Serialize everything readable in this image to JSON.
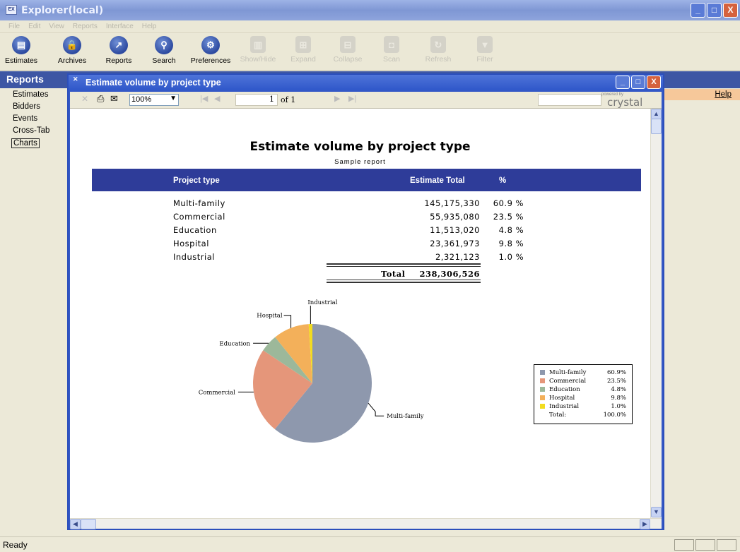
{
  "app": {
    "title": "Explorer(local)",
    "icon": "app-window-icon",
    "icon_text": "EX"
  },
  "window_controls": {
    "minimize": "_",
    "maximize": "□",
    "close": "X"
  },
  "menu": [
    "File",
    "Edit",
    "View",
    "Reports",
    "Interface",
    "Help"
  ],
  "toolbar": [
    {
      "label": "Estimates",
      "icon": "estimates-icon",
      "glyph": "▤",
      "enabled": true
    },
    {
      "label": "Archives",
      "icon": "archives-icon",
      "glyph": "🔒",
      "enabled": true
    },
    {
      "label": "Reports",
      "icon": "reports-icon",
      "glyph": "↗",
      "enabled": true
    },
    {
      "label": "Search",
      "icon": "search-icon",
      "glyph": "⚲",
      "enabled": true
    },
    {
      "label": "Preferences",
      "icon": "preferences-icon",
      "glyph": "⚙",
      "enabled": true
    },
    {
      "label": "Show/Hide",
      "icon": "show-hide-icon",
      "glyph": "▥",
      "enabled": false
    },
    {
      "label": "Expand",
      "icon": "expand-icon",
      "glyph": "⊞",
      "enabled": false
    },
    {
      "label": "Collapse",
      "icon": "collapse-icon",
      "glyph": "⊟",
      "enabled": false
    },
    {
      "label": "Scan",
      "icon": "scan-icon",
      "glyph": "◘",
      "enabled": false
    },
    {
      "label": "Refresh",
      "icon": "refresh-icon",
      "glyph": "↻",
      "enabled": false
    },
    {
      "label": "Filter",
      "icon": "filter-icon",
      "glyph": "▼",
      "enabled": false
    }
  ],
  "sidebar": {
    "title": "Reports",
    "items": [
      {
        "label": "Estimates"
      },
      {
        "label": "Bidders"
      },
      {
        "label": "Events"
      },
      {
        "label": "Cross-Tab"
      },
      {
        "label": "Charts",
        "selected": true
      }
    ]
  },
  "help": {
    "label": "Help"
  },
  "report_window": {
    "title": "Estimate volume by project type",
    "viewer": {
      "zoom": "100%",
      "page": "1",
      "of": "of 1",
      "powered_by": "powered by",
      "brand": "crystal"
    }
  },
  "report": {
    "title": "Estimate volume by project type",
    "subtitle": "Sample report",
    "headers": {
      "type": "Project type",
      "total": "Estimate Total",
      "pct": "%"
    },
    "rows": [
      {
        "type": "Multi-family",
        "total": "145,175,330",
        "pct": "60.9 %"
      },
      {
        "type": "Commercial",
        "total": "55,935,080",
        "pct": "23.5 %"
      },
      {
        "type": "Education",
        "total": "11,513,020",
        "pct": "4.8 %"
      },
      {
        "type": "Hospital",
        "total": "23,361,973",
        "pct": "9.8 %"
      },
      {
        "type": "Industrial",
        "total": "2,321,123",
        "pct": "1.0 %"
      }
    ],
    "total_label": "Total",
    "total_value": "238,306,526"
  },
  "chart_data": {
    "type": "pie",
    "categories": [
      "Multi-family",
      "Commercial",
      "Education",
      "Hospital",
      "Industrial"
    ],
    "values": [
      60.9,
      23.5,
      4.8,
      9.8,
      1.0
    ],
    "colors": [
      "#8e98ad",
      "#e5967a",
      "#9cb89a",
      "#f3b05a",
      "#f2dc1e"
    ],
    "legend": {
      "entries": [
        {
          "name": "Multi-family",
          "pct": "60.9%"
        },
        {
          "name": "Commercial",
          "pct": "23.5%"
        },
        {
          "name": "Education",
          "pct": "4.8%"
        },
        {
          "name": "Hospital",
          "pct": "9.8%"
        },
        {
          "name": "Industrial",
          "pct": "1.0%"
        }
      ],
      "total_label": "Total:",
      "total_pct": "100.0%",
      "placement": "right"
    }
  },
  "status": {
    "text": "Ready"
  }
}
